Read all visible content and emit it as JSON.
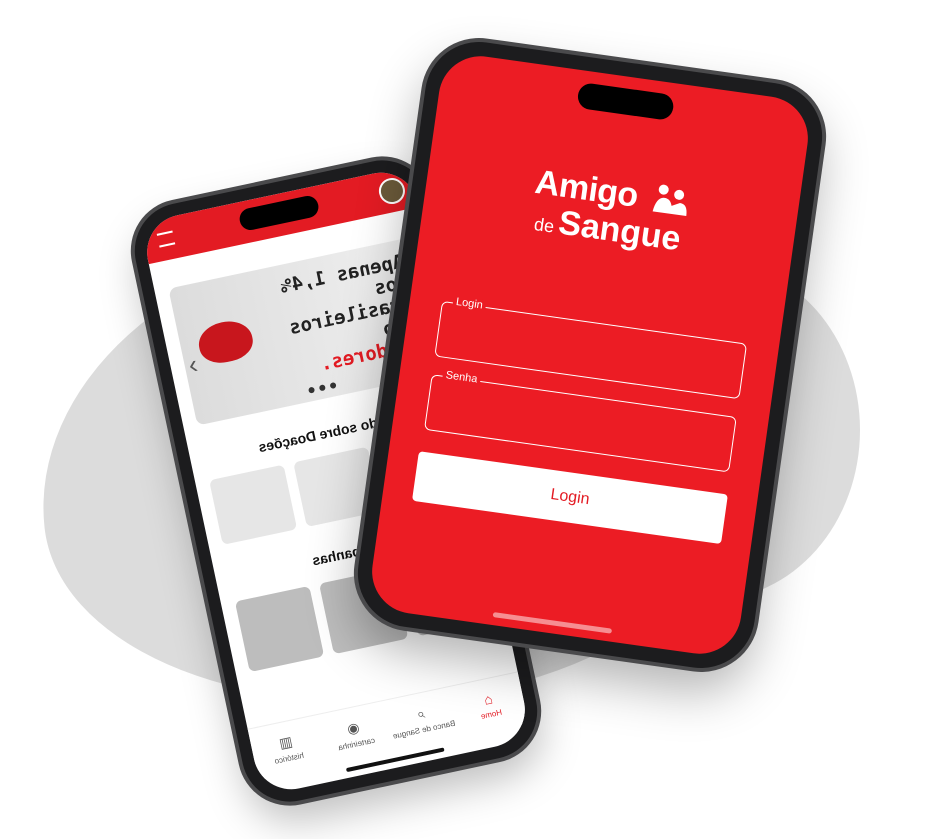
{
  "home_screen": {
    "banner": {
      "line1": "Apenas 1,4% dos",
      "line2": "brasileiros são",
      "highlight": "doadores."
    },
    "section_donations_title": "Tudo sobre Doações",
    "section_campaigns_title": "Campanhas",
    "tabs": [
      {
        "label": "Home",
        "icon": "home-icon"
      },
      {
        "label": "Banco de Sangue",
        "icon": "search-icon"
      },
      {
        "label": "carteirinha",
        "icon": "broadcast-icon"
      },
      {
        "label": "histórico",
        "icon": "bars-icon"
      }
    ]
  },
  "login_screen": {
    "logo": {
      "line1": "Amigo",
      "prefix": "de",
      "line2": "Sangue",
      "icon": "people-hug-icon"
    },
    "login_field": {
      "label": "Login",
      "value": ""
    },
    "password_field": {
      "label": "Senha",
      "value": ""
    },
    "login_button": "Login"
  },
  "colors": {
    "brand_red": "#ec1c24"
  }
}
